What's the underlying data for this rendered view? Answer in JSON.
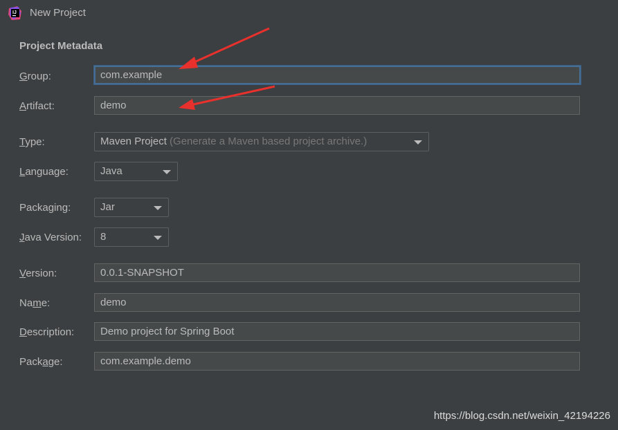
{
  "window": {
    "title": "New Project",
    "icon": "intellij-idea-icon"
  },
  "section_title": "Project Metadata",
  "fields": {
    "group": {
      "label_mnemonic": "G",
      "label_rest": "roup:",
      "value": "com.example"
    },
    "artifact": {
      "label_mnemonic": "A",
      "label_rest": "rtifact:",
      "value": "demo"
    },
    "type": {
      "label_mnemonic": "T",
      "label_rest": "ype:",
      "value": "Maven Project",
      "hint": "(Generate a Maven based project archive.)"
    },
    "language": {
      "label_mnemonic": "L",
      "label_rest": "anguage:",
      "value": "Java"
    },
    "packaging": {
      "label_pre": "Packa",
      "label_mnemonic": "g",
      "label_rest": "ing:",
      "value": "Jar"
    },
    "java_version": {
      "label_mnemonic": "J",
      "label_rest": "ava Version:",
      "value": "8"
    },
    "version": {
      "label_mnemonic": "V",
      "label_rest": "ersion:",
      "value": "0.0.1-SNAPSHOT"
    },
    "name": {
      "label_pre": "Na",
      "label_mnemonic": "m",
      "label_rest": "e:",
      "value": "demo"
    },
    "description": {
      "label_mnemonic": "D",
      "label_rest": "escription:",
      "value": "Demo project for Spring Boot"
    },
    "package": {
      "label_pre": "Pack",
      "label_mnemonic": "a",
      "label_rest": "ge:",
      "value": "com.example.demo"
    }
  },
  "watermark": "https://blog.csdn.net/weixin_42194226",
  "colors": {
    "background": "#3c3f41",
    "field_bg": "#45494a",
    "focus_border": "#466d94",
    "annotation_arrow": "#e8302c"
  }
}
